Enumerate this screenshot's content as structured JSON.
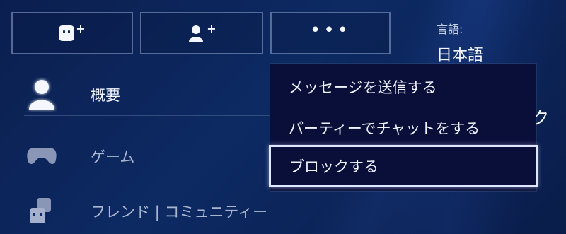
{
  "top_buttons": [
    {
      "name": "add-friend",
      "icon": "face-plus-icon",
      "plus": "+"
    },
    {
      "name": "add-user",
      "icon": "user-plus-icon",
      "plus": "+"
    },
    {
      "name": "more",
      "icon": "more-dots-icon",
      "label": "•••"
    }
  ],
  "language": {
    "label": "言語:",
    "value": "日本語"
  },
  "right_fragment": "ク",
  "list": {
    "items": [
      {
        "label": "概要",
        "icon": "user-icon"
      },
      {
        "label": "ゲーム",
        "icon": "gamepad-icon"
      },
      {
        "label": "フレンド | コミュニティー",
        "icon": "friends-icon"
      }
    ]
  },
  "menu": {
    "items": [
      {
        "label": "メッセージを送信する"
      },
      {
        "label": "パーティーでチャットをする"
      },
      {
        "label": "ブロックする",
        "selected": true
      }
    ]
  },
  "colors": {
    "background": "#0d2a63",
    "menu_bg": "#0a0f3a",
    "text": "#f4f7ff",
    "muted_text": "#aab6d0",
    "focus_border": "#dfe6ff"
  }
}
